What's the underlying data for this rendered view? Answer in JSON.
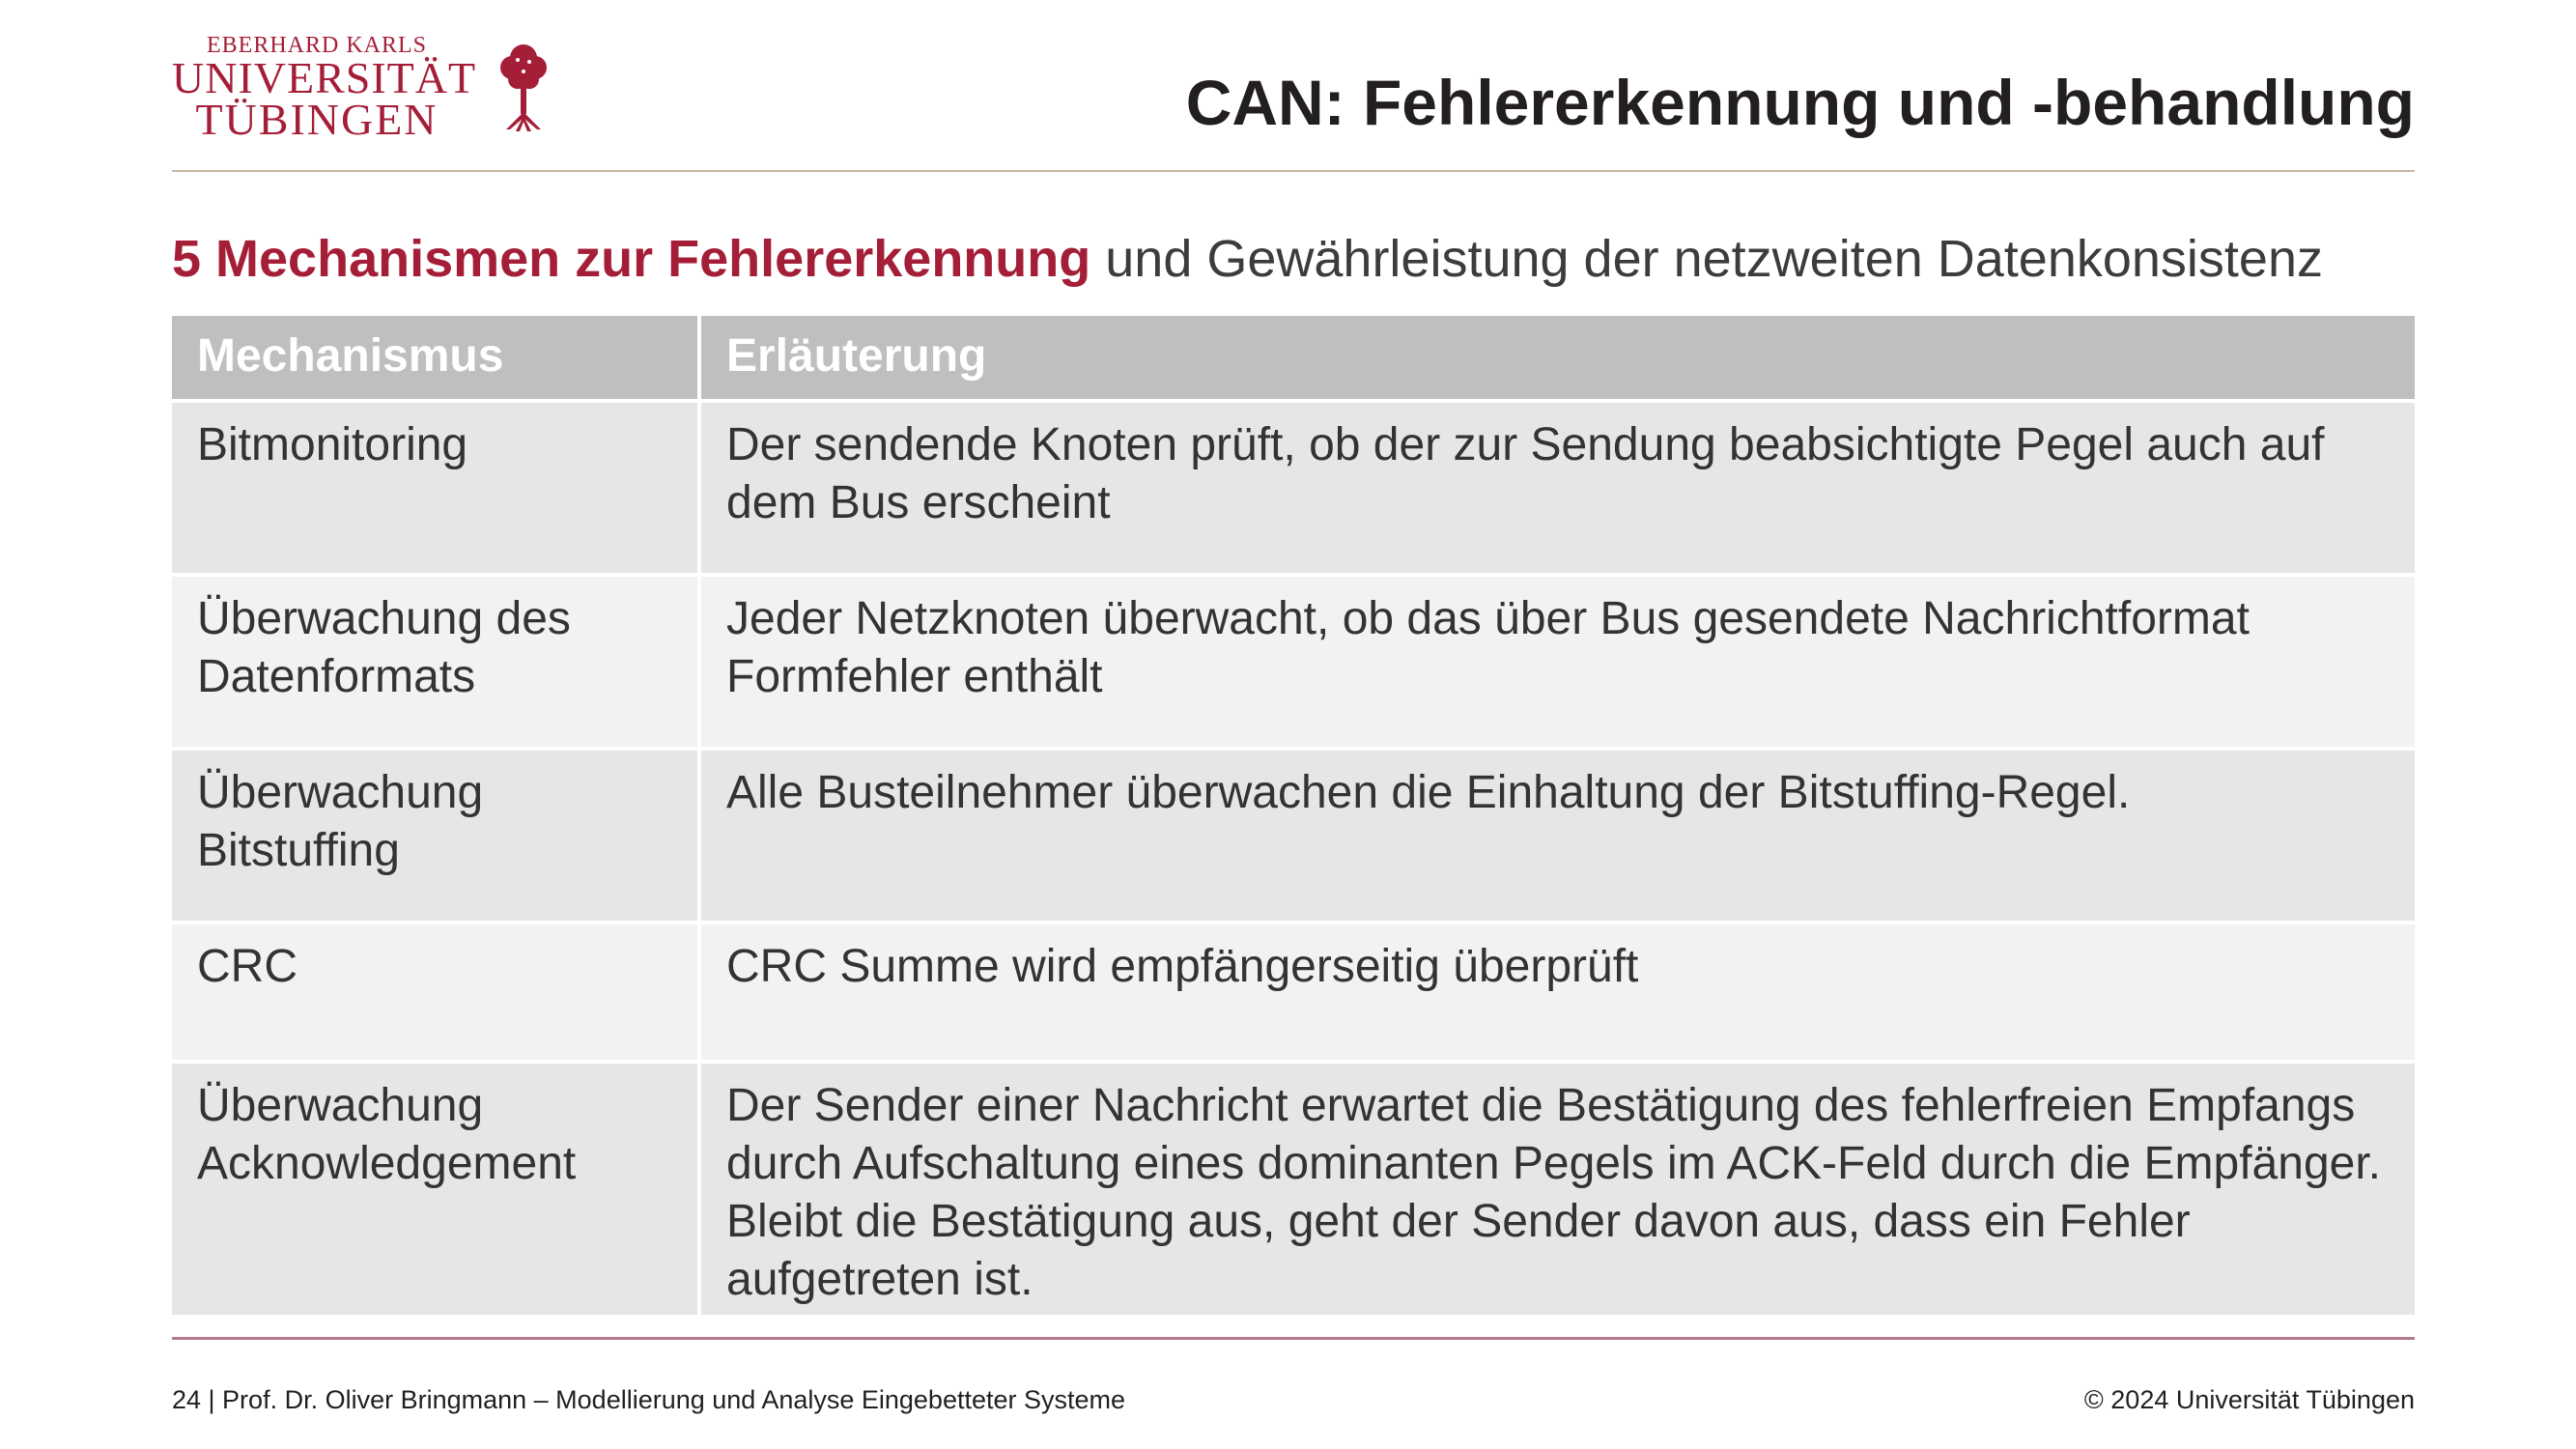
{
  "logo": {
    "line1": "EBERHARD KARLS",
    "line2": "UNIVERSITÄT",
    "line3": "TÜBINGEN",
    "icon": "tree-icon",
    "color": "#a51e37"
  },
  "header": {
    "title": "CAN: Fehlererkennung und -behandlung"
  },
  "subtitle": {
    "accent": "5 Mechanismen zur Fehlererkennung",
    "rest": " und Gewährleistung der netzweiten Datenkonsistenz"
  },
  "table": {
    "columns": [
      "Mechanismus",
      "Erläuterung"
    ],
    "rows": [
      {
        "mechanism": "Bitmonitoring",
        "explanation": "Der sendende Knoten prüft, ob der zur Sendung beabsichtigte Pegel auch auf dem Bus erscheint"
      },
      {
        "mechanism": "Überwachung des Datenformats",
        "explanation": "Jeder Netzknoten überwacht, ob das über Bus gesendete Nachrichtformat Formfehler enthält"
      },
      {
        "mechanism": "Überwachung Bitstuffing",
        "explanation": "Alle Busteilnehmer überwachen die Einhaltung der Bitstuffing-Regel."
      },
      {
        "mechanism": "CRC",
        "explanation": "CRC Summe wird empfängerseitig überprüft"
      },
      {
        "mechanism": "Überwachung Acknowledgement",
        "explanation": "Der Sender einer Nachricht erwartet die Bestätigung des fehlerfreien Empfangs durch Aufschaltung eines dominanten Pegels im ACK-Feld durch die Empfänger. Bleibt die Bestätigung aus, geht der Sender davon aus, dass ein Fehler aufgetreten ist."
      }
    ]
  },
  "footer": {
    "left": "24 | Prof. Dr. Oliver Bringmann – Modellierung und Analyse Eingebetteter Systeme",
    "right": "© 2024 Universität Tübingen"
  }
}
